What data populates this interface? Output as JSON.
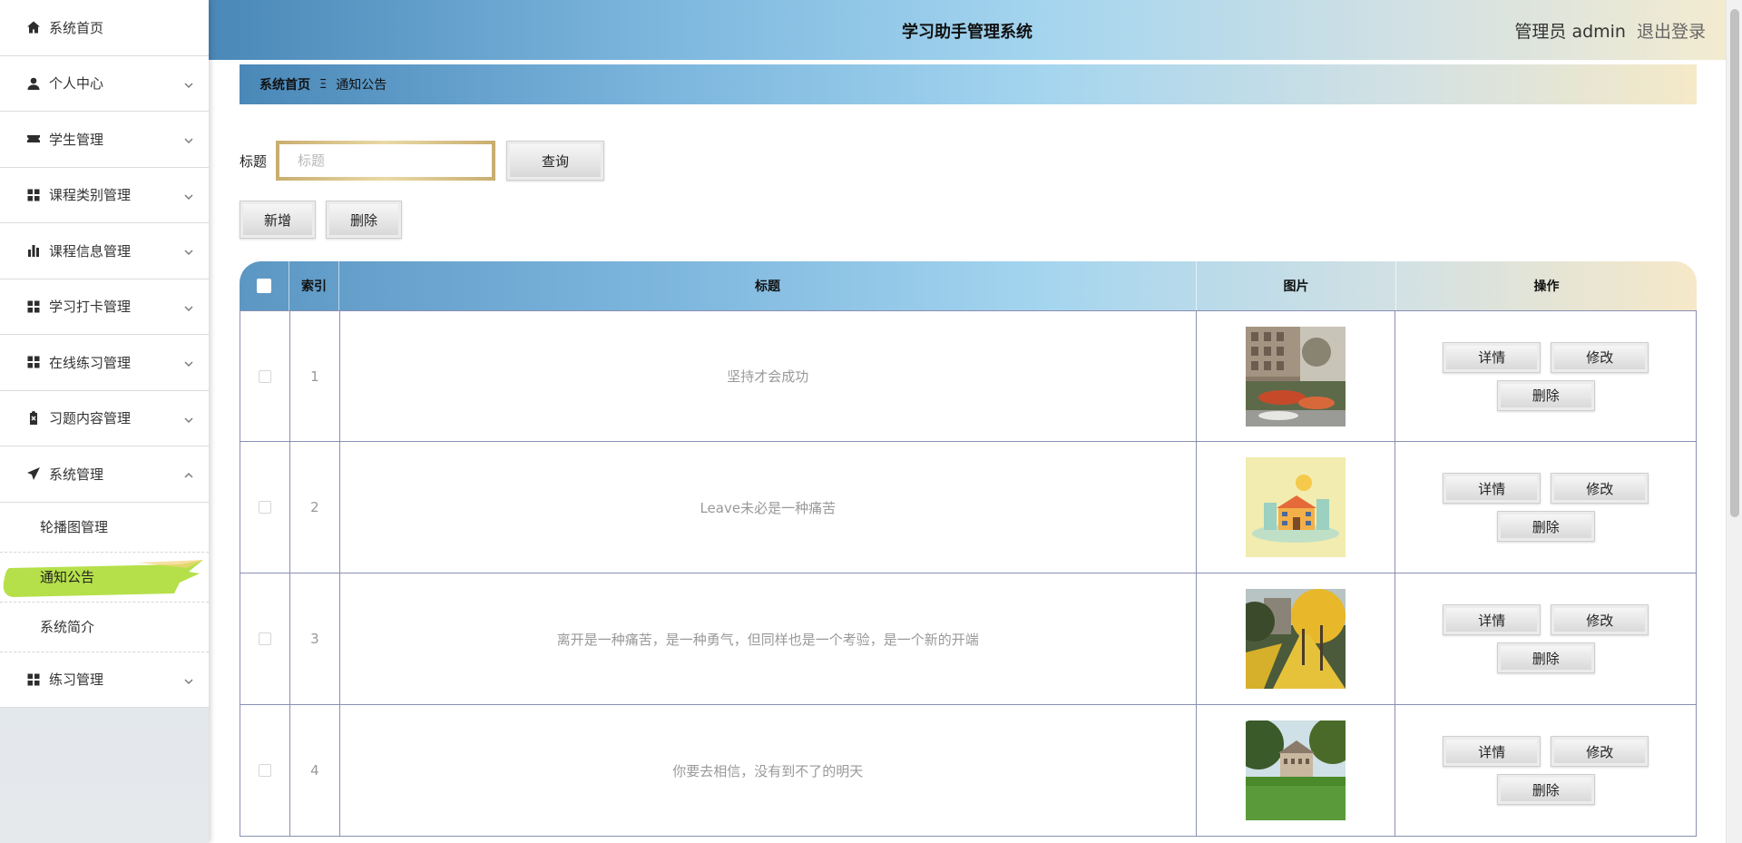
{
  "header": {
    "system_title": "学习助手管理系统",
    "admin_label": "管理员 admin",
    "logout_label": "退出登录"
  },
  "sidebar": {
    "items": [
      {
        "label": "系统首页",
        "icon": "home-icon"
      },
      {
        "label": "个人中心",
        "icon": "user-icon"
      },
      {
        "label": "学生管理",
        "icon": "ticket-icon"
      },
      {
        "label": "课程类别管理",
        "icon": "grid-icon"
      },
      {
        "label": "课程信息管理",
        "icon": "bar-chart-icon"
      },
      {
        "label": "学习打卡管理",
        "icon": "grid-icon"
      },
      {
        "label": "在线练习管理",
        "icon": "grid-icon"
      },
      {
        "label": "习题内容管理",
        "icon": "clipboard-icon"
      },
      {
        "label": "系统管理",
        "icon": "send-icon"
      },
      {
        "label": "练习管理",
        "icon": "grid-icon"
      }
    ],
    "system_submenu": [
      {
        "label": "轮播图管理"
      },
      {
        "label": "通知公告"
      },
      {
        "label": "系统简介"
      }
    ],
    "active_color": "#b5e04a"
  },
  "breadcrumb": {
    "home": "系统首页",
    "separator": "Ξ",
    "current": "通知公告"
  },
  "search": {
    "label": "标题",
    "placeholder": "标题",
    "query_button": "查询"
  },
  "actions": {
    "add_button": "新增",
    "delete_button": "删除"
  },
  "table": {
    "columns": {
      "index": "索引",
      "title": "标题",
      "image": "图片",
      "operation": "操作"
    },
    "row_buttons": {
      "detail": "详情",
      "edit": "修改",
      "delete": "删除"
    },
    "rows": [
      {
        "index": "1",
        "title": "坚持才会成功",
        "image": "campus-courtyard-photo"
      },
      {
        "index": "2",
        "title": "Leave未必是一种痛苦",
        "image": "school-building-illustration"
      },
      {
        "index": "3",
        "title": "离开是一种痛苦，是一种勇气，但同样也是一个考验，是一个新的开端",
        "image": "ginkgo-avenue-photo"
      },
      {
        "index": "4",
        "title": "你要去相信，没有到不了的明天",
        "image": "campus-lawn-photo"
      }
    ]
  }
}
